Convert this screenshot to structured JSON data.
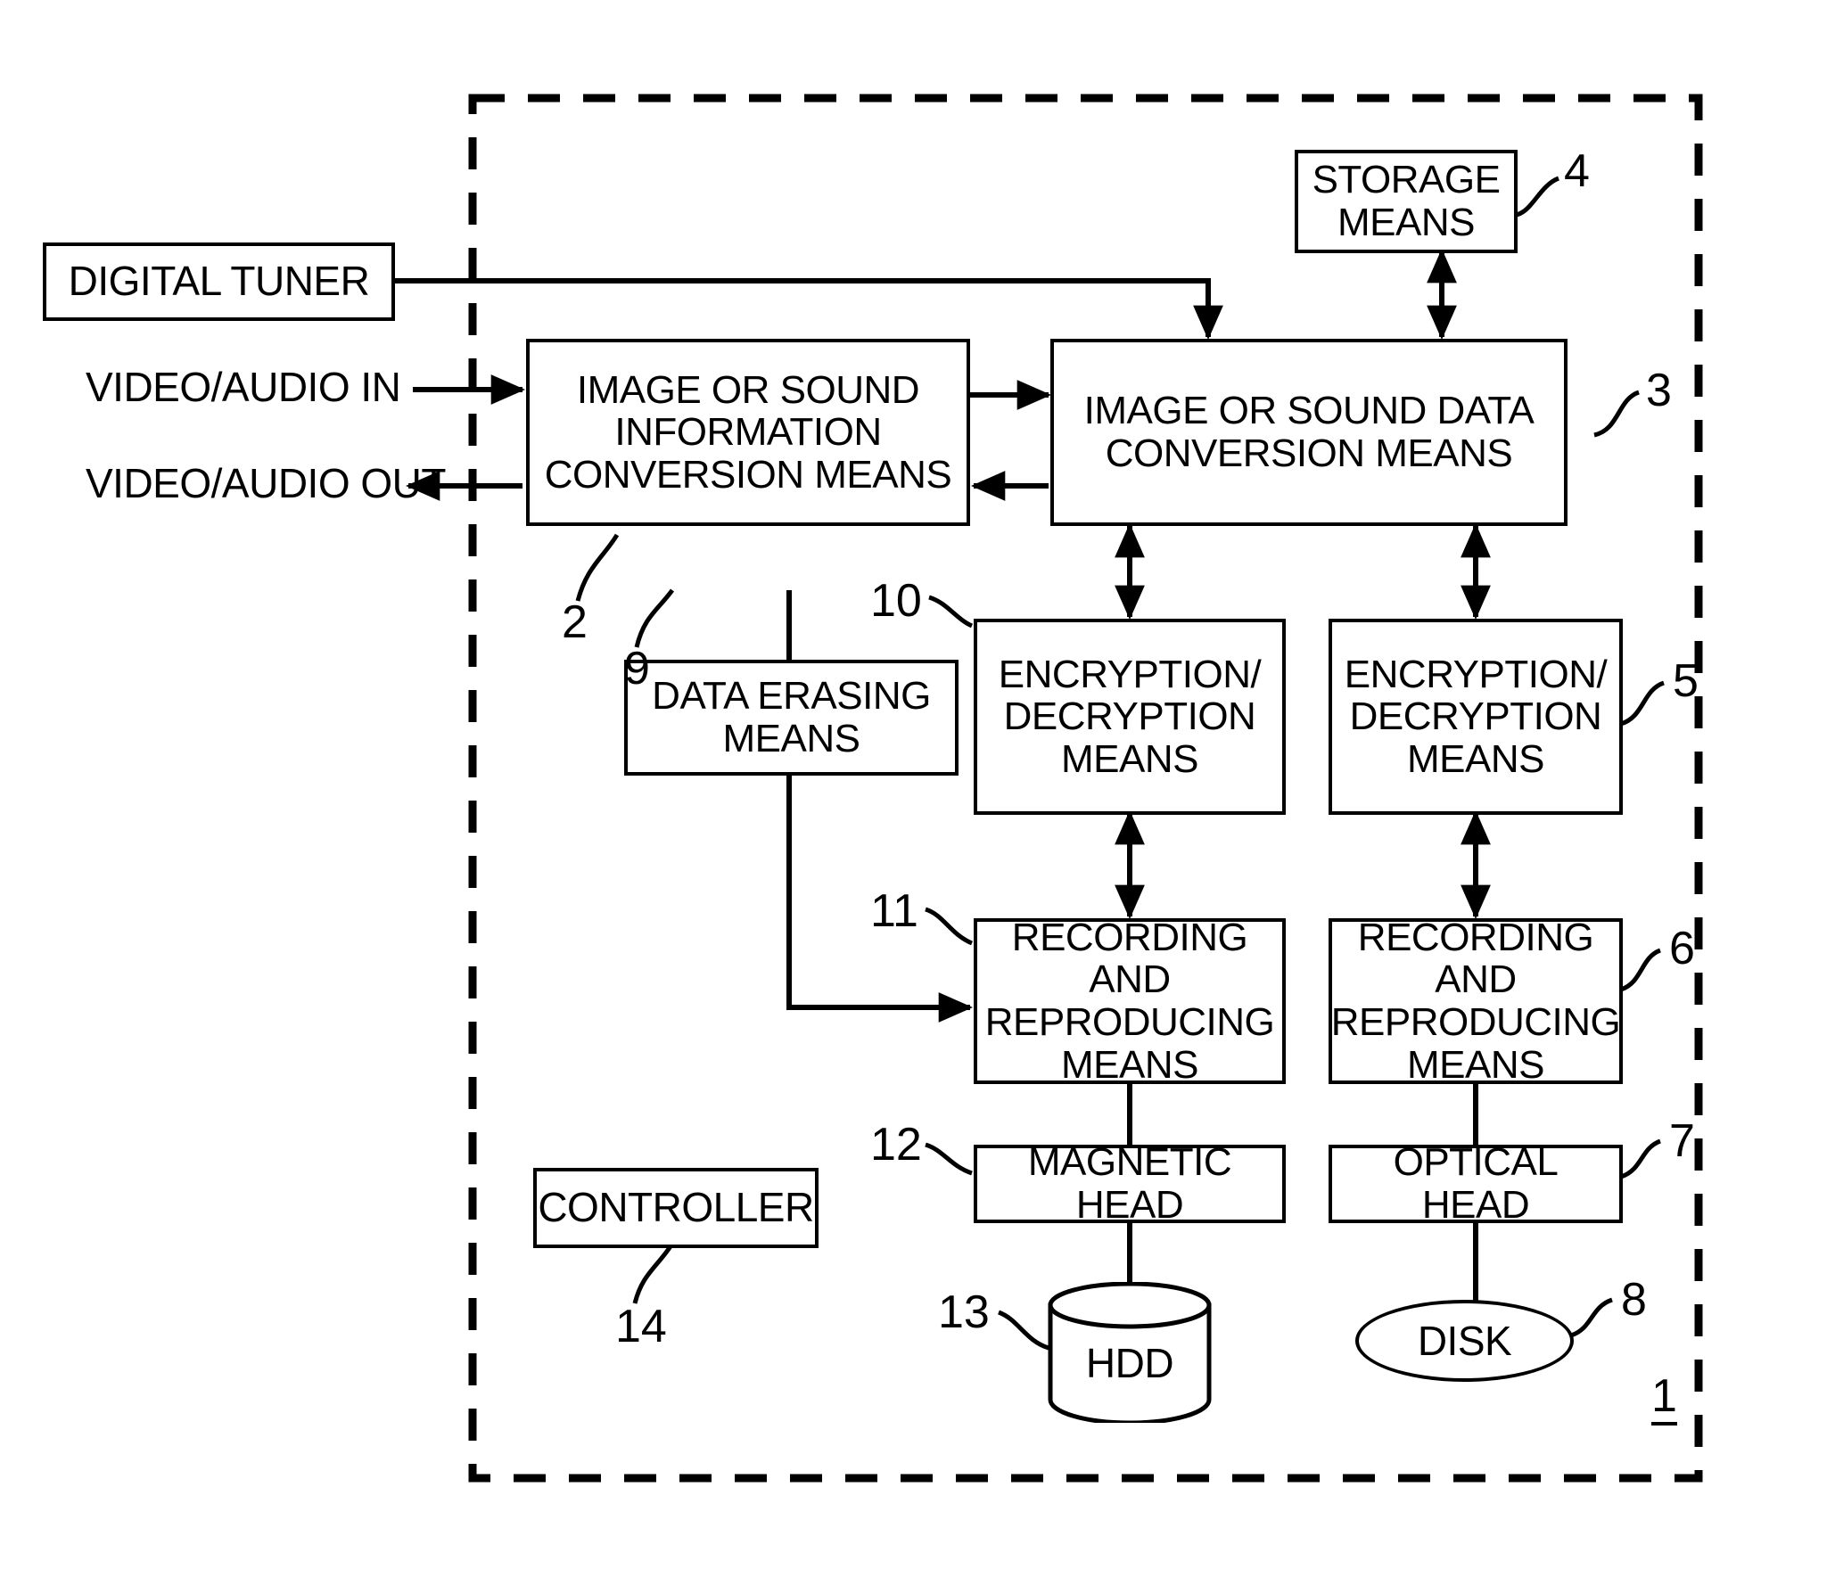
{
  "figure": {
    "type": "patent-block-diagram",
    "outer_boundary_style": "dashed",
    "system_ref": "1",
    "colors": {
      "line": "#000000",
      "background": "#ffffff"
    }
  },
  "external_labels": {
    "video_audio_in": "VIDEO/AUDIO IN",
    "video_audio_out": "VIDEO/AUDIO OUT"
  },
  "blocks": {
    "digital_tuner": {
      "label": "DIGITAL TUNER",
      "ref": ""
    },
    "info_conversion": {
      "label": "IMAGE OR SOUND\nINFORMATION\nCONVERSION MEANS",
      "ref": "2"
    },
    "data_conversion": {
      "label": "IMAGE OR SOUND DATA\nCONVERSION MEANS",
      "ref": "3"
    },
    "storage_means": {
      "label": "STORAGE\nMEANS",
      "ref": "4"
    },
    "data_erasing": {
      "label": "DATA ERASING\nMEANS",
      "ref": "9"
    },
    "encdec_left": {
      "label": "ENCRYPTION/\nDECRYPTION\nMEANS",
      "ref": "10"
    },
    "encdec_right": {
      "label": "ENCRYPTION/\nDECRYPTION\nMEANS",
      "ref": "5"
    },
    "recrep_left": {
      "label": "RECORDING AND\nREPRODUCING\nMEANS",
      "ref": "11"
    },
    "recrep_right": {
      "label": "RECORDING AND\nREPRODUCING\nMEANS",
      "ref": "6"
    },
    "magnetic_head": {
      "label": "MAGNETIC HEAD",
      "ref": "12"
    },
    "optical_head": {
      "label": "OPTICAL HEAD",
      "ref": "7"
    },
    "hdd": {
      "label": "HDD",
      "ref": "13"
    },
    "disk": {
      "label": "DISK",
      "ref": "8"
    },
    "controller": {
      "label": "CONTROLLER",
      "ref": "14"
    }
  },
  "reference_numerals": {
    "n1": "1",
    "n2": "2",
    "n3": "3",
    "n4": "4",
    "n5": "5",
    "n6": "6",
    "n7": "7",
    "n8": "8",
    "n9": "9",
    "n10": "10",
    "n11": "11",
    "n12": "12",
    "n13": "13",
    "n14": "14"
  }
}
